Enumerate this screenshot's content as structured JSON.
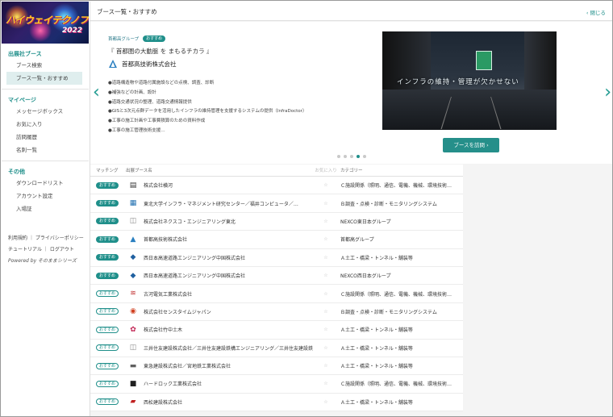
{
  "logo": {
    "text": "ハイウェイテクノフェア",
    "year": "2022"
  },
  "sidebar": {
    "sections": [
      {
        "heading": "出展社ブース",
        "items": [
          {
            "label": "ブース検索",
            "active": false
          },
          {
            "label": "ブース一覧・おすすめ",
            "active": true
          }
        ]
      },
      {
        "heading": "マイページ",
        "items": [
          {
            "label": "メッセージボックス",
            "active": false
          },
          {
            "label": "お気に入り",
            "active": false
          },
          {
            "label": "訪問履歴",
            "active": false
          },
          {
            "label": "名刺一覧",
            "active": false
          }
        ]
      },
      {
        "heading": "その他",
        "items": [
          {
            "label": "ダウンロードリスト",
            "active": false
          },
          {
            "label": "アカウント設定",
            "active": false
          },
          {
            "label": "入場証",
            "active": false
          }
        ]
      }
    ],
    "footer": {
      "terms": "利用規約",
      "privacy": "プライバシーポリシー",
      "tutorial": "チュートリアル",
      "logout": "ログアウト",
      "powered": "Powered by そのままシリーズ",
      "sep": "｜"
    }
  },
  "header": {
    "title": "ブース一覧・おすすめ",
    "close": "‹ 閉じる"
  },
  "carousel": {
    "category": "首都高グループ",
    "badge": "おすすめ",
    "slogan": "『 首都圏の大動脈 を まもるチカラ 』",
    "company": "首都高技術株式会社",
    "bullets": [
      "●道路構造物や道路付属施設などの点検、調査、診断",
      "●補強などの計画、設計",
      "●道路交通状況の整理、道路交通情報提供",
      "●GISと3次元点群データを活用したインフラの維持管理を支援するシステムの提供（InfraDoctor）",
      "●工事の施工計画や工事費積算のための資料作成",
      "●工事の施工管理技術支援…"
    ],
    "image_caption": "インフラの維持・管理が欠かせない",
    "visit_button": "ブースを訪問 ›",
    "dots_total": 5,
    "dots_active": 4,
    "prev": "‹",
    "next": "›"
  },
  "table": {
    "headers": {
      "match": "マッチング",
      "name": "出展ブース名",
      "fav": "お気に入り",
      "cat": "カテゴリー"
    },
    "rows": [
      {
        "match": "おすすめ",
        "match_style": "solid",
        "logo": "▤",
        "logo_color": "#333333",
        "name": "株式会社横河",
        "cat": "Ｃ施設関係（照明、通信、電機、機械、環境技術…"
      },
      {
        "match": "おすすめ",
        "match_style": "solid",
        "logo": "▦",
        "logo_color": "#1f6fb0",
        "name": "東北大学インフラ・マネジメント研究センター／福井コンピュータ／…",
        "cat": "Ｂ調査・点検・診断・モニタリングシステム"
      },
      {
        "match": "おすすめ",
        "match_style": "solid",
        "logo": "◫",
        "logo_color": "#8a8a8a",
        "name": "株式会社ネクスコ・エンジニアリング東北",
        "cat": "NEXCO東日本グループ"
      },
      {
        "match": "おすすめ",
        "match_style": "solid",
        "logo": "▲",
        "logo_color": "#2a7fc0",
        "name": "首都高技術株式会社",
        "cat": "首都高グループ"
      },
      {
        "match": "おすすめ",
        "match_style": "solid",
        "logo": "◆",
        "logo_color": "#2060a0",
        "name": "西日本高速道路エンジニアリング中国株式会社",
        "cat": "Ａ土工・橋梁・トンネル・舗装等"
      },
      {
        "match": "おすすめ",
        "match_style": "solid",
        "logo": "◆",
        "logo_color": "#2060a0",
        "name": "西日本高速道路エンジニアリング中国株式会社",
        "cat": "NEXCO西日本グループ"
      },
      {
        "match": "おすすめ",
        "match_style": "outline",
        "logo": "≋",
        "logo_color": "#c03030",
        "name": "古河電気工業株式会社",
        "cat": "Ｃ施設関係（照明、通信、電機、機械、環境技術…"
      },
      {
        "match": "おすすめ",
        "match_style": "outline",
        "logo": "◉",
        "logo_color": "#d04020",
        "name": "株式会社センスタイムジャパン",
        "cat": "Ｂ調査・点検・診断・モニタリングシステム"
      },
      {
        "match": "おすすめ",
        "match_style": "outline",
        "logo": "✿",
        "logo_color": "#c02050",
        "name": "株式会社竹中土木",
        "cat": "Ａ土工・橋梁・トンネル・舗装等"
      },
      {
        "match": "おすすめ",
        "match_style": "outline",
        "logo": "◫",
        "logo_color": "#8a8a8a",
        "name": "三井住友建設株式会社／三井住友建設鉄構エンジニアリング／三井住友建設鉄構エン…",
        "cat": "Ａ土工・橋梁・トンネル・舗装等"
      },
      {
        "match": "おすすめ",
        "match_style": "outline",
        "logo": "▬",
        "logo_color": "#606060",
        "name": "東急建設株式会社／宮地鉄工業株式会社",
        "cat": "Ａ土工・橋梁・トンネル・舗装等"
      },
      {
        "match": "おすすめ",
        "match_style": "outline",
        "logo": "■",
        "logo_color": "#202020",
        "name": "ハードロック工業株式会社",
        "cat": "Ｃ施設関係（照明、通信、電機、機械、環境技術…"
      },
      {
        "match": "おすすめ",
        "match_style": "outline",
        "logo": "▰",
        "logo_color": "#c02020",
        "name": "西松建設株式会社",
        "cat": "Ａ土工・橋梁・トンネル・舗装等"
      }
    ]
  },
  "colors": {
    "accent": "#1f8f8a",
    "button": "#258f8a"
  }
}
